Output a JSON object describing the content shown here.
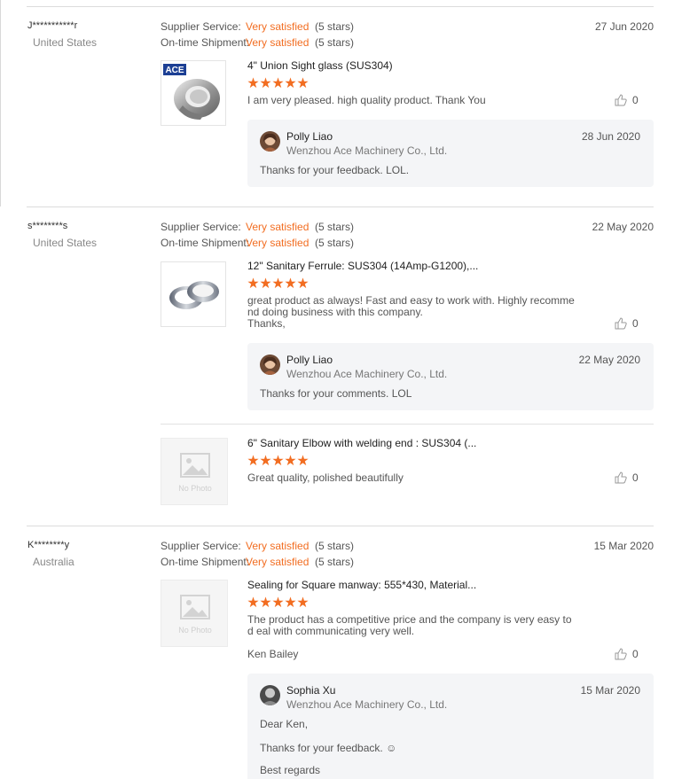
{
  "labels": {
    "supplier_service": "Supplier Service:",
    "ontime_shipment": "On-time Shipment:",
    "no_photo": "No Photo"
  },
  "colors": {
    "accent": "#f26d21",
    "reply_bg": "#f4f5f7"
  },
  "reviews": [
    {
      "buyer": "J***********r",
      "country": "United States",
      "date": "27 Jun 2020",
      "supplier_service": {
        "value": "Very satisfied",
        "stars": "(5 stars)"
      },
      "ontime_shipment": {
        "value": "Very satisfied",
        "stars": "(5 stars)"
      },
      "products": [
        {
          "title": "4\" Union Sight glass (SUS304)",
          "rating": 5,
          "text": "I am very pleased.  high quality product.  Thank You",
          "likes": "0",
          "image": "union-sight-glass",
          "logo_text": "ACE",
          "reply": {
            "name": "Polly Liao",
            "company": "Wenzhou Ace Machinery Co., Ltd.",
            "date": "28 Jun 2020",
            "text": "Thanks for your feedback. LOL."
          }
        }
      ]
    },
    {
      "buyer": "s********s",
      "country": "United States",
      "date": "22 May 2020",
      "supplier_service": {
        "value": "Very satisfied",
        "stars": "(5 stars)"
      },
      "ontime_shipment": {
        "value": "Very satisfied",
        "stars": "(5 stars)"
      },
      "products": [
        {
          "title": "12\" Sanitary Ferrule: SUS304 (14Amp-G1200),...",
          "rating": 5,
          "text": "great product as always!  Fast and easy to work with.  Highly recomme nd doing business with this company.",
          "text2": "Thanks,",
          "likes": "0",
          "image": "sanitary-ferrule",
          "reply": {
            "name": "Polly Liao",
            "company": "Wenzhou Ace Machinery Co., Ltd.",
            "date": "22 May 2020",
            "text": "Thanks for your comments. LOL"
          }
        },
        {
          "title": "6\" Sanitary Elbow with welding end : SUS304 (...",
          "rating": 5,
          "text": "Great quality, polished beautifully",
          "likes": "0",
          "image": "no-photo"
        }
      ]
    },
    {
      "buyer": "K********y",
      "country": "Australia",
      "date": "15 Mar 2020",
      "supplier_service": {
        "value": "Very satisfied",
        "stars": "(5 stars)"
      },
      "ontime_shipment": {
        "value": "Very satisfied",
        "stars": "(5 stars)"
      },
      "products": [
        {
          "title": "Sealing for Square manway: 555*430, Material...",
          "rating": 5,
          "text": "The product has a competitive price and the company is very easy to d eal  with communicating very well.",
          "signature": "Ken Bailey",
          "likes": "0",
          "image": "no-photo",
          "reply": {
            "name": "Sophia Xu",
            "company": "Wenzhou Ace Machinery Co., Ltd.",
            "date": "15 Mar 2020",
            "greeting": "Dear Ken,",
            "text": "Thanks for your feedback. ☺",
            "closing": "Best regards"
          }
        }
      ]
    }
  ]
}
